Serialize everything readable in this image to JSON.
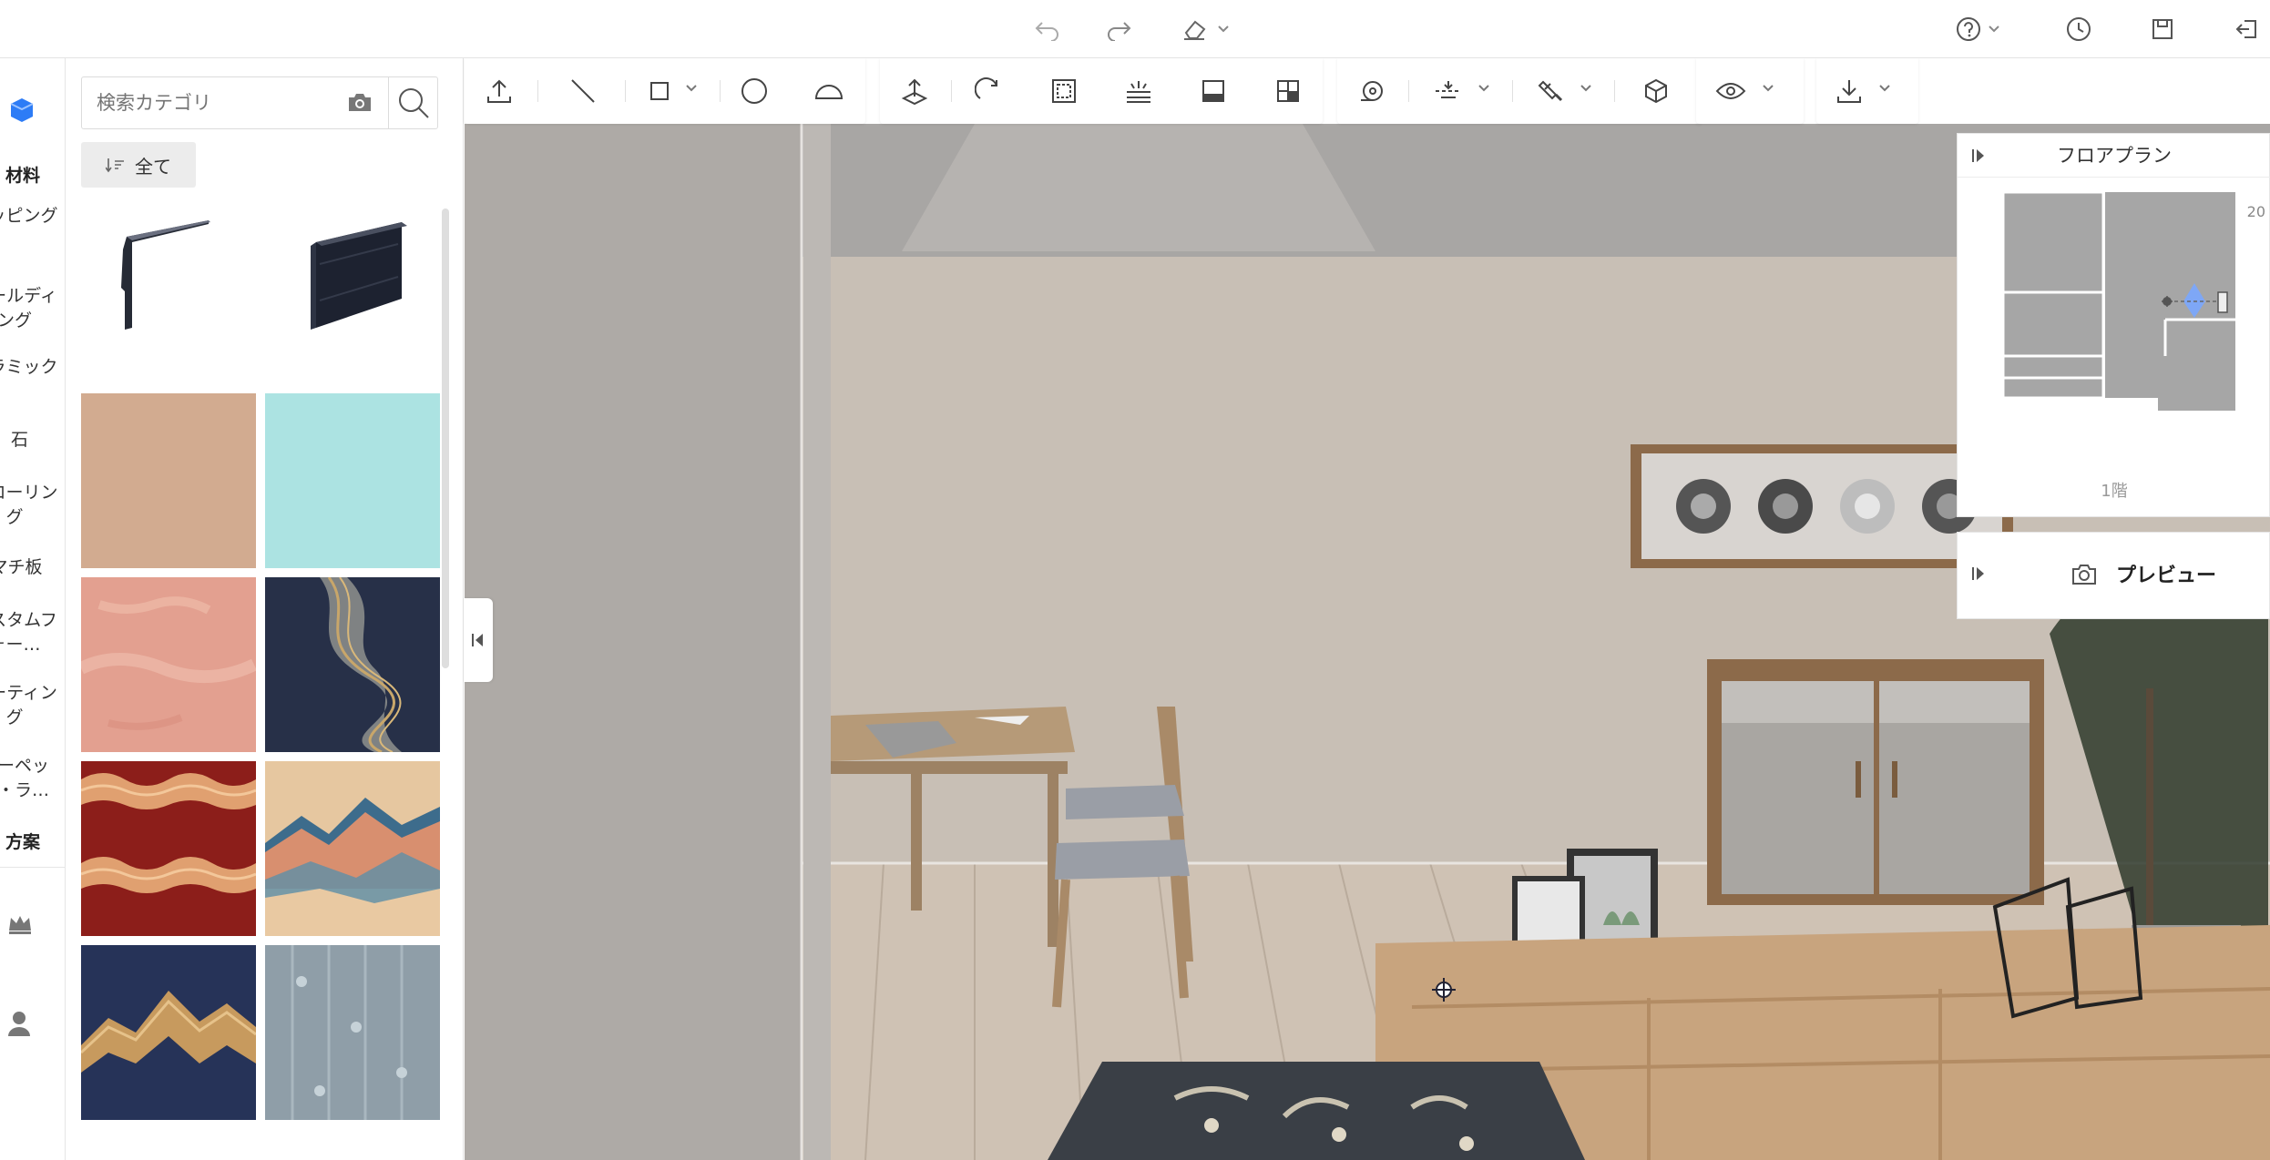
{
  "topbar": {
    "icons": [
      "undo-icon",
      "redo-icon",
      "eraser-icon",
      "help-icon",
      "history-icon",
      "save-icon",
      "exit-icon"
    ]
  },
  "rail": {
    "head_materials": "材料",
    "items": [
      "ラッピング",
      "モールディング",
      "セラミック",
      "石",
      "フローリング",
      "マチ板",
      "カスタムフォー…",
      "コーティング",
      "カーペット・ラ…"
    ],
    "head_plans": "方案"
  },
  "panel": {
    "search_placeholder": "検索カテゴリ",
    "filter_label": "全て",
    "tiles": [
      {
        "kind": "molding-profile",
        "color": "#2b3140"
      },
      {
        "kind": "molding-panel",
        "color": "#1f2533"
      },
      {
        "kind": "solid",
        "color": "#d2ab90"
      },
      {
        "kind": "solid",
        "color": "#ace3e2"
      },
      {
        "kind": "distressed",
        "color": "#e3a090"
      },
      {
        "kind": "marble-navy-gold",
        "color": "#273048"
      },
      {
        "kind": "waves-red",
        "color": "#8c1e1a"
      },
      {
        "kind": "mountains-cream-blue",
        "color": "#d8b48e"
      },
      {
        "kind": "mountains-navy-gold",
        "color": "#263358"
      },
      {
        "kind": "fabric-grey-blue",
        "color": "#8f9ea8"
      }
    ]
  },
  "toolbar": {
    "tools": [
      "upload-icon",
      "line-tool-icon",
      "rectangle-tool-icon",
      "circle-tool-icon",
      "arc-tool-icon",
      "place-tool-icon",
      "rotate-tool-icon",
      "select-area-icon",
      "ceiling-light-icon",
      "floor-panel-icon",
      "layout-icon",
      "measure-tape-icon",
      "align-icon",
      "paint-brush-icon",
      "cube-icon",
      "visibility-icon",
      "download-icon"
    ]
  },
  "floorplan": {
    "title": "フロアプラン",
    "scale": "20",
    "floor": "1階"
  },
  "preview": {
    "title": "プレビュー"
  },
  "colors": {
    "accent": "#2d7cf6",
    "wall": "#c9bfb5",
    "floor": "#cfc2b4"
  }
}
